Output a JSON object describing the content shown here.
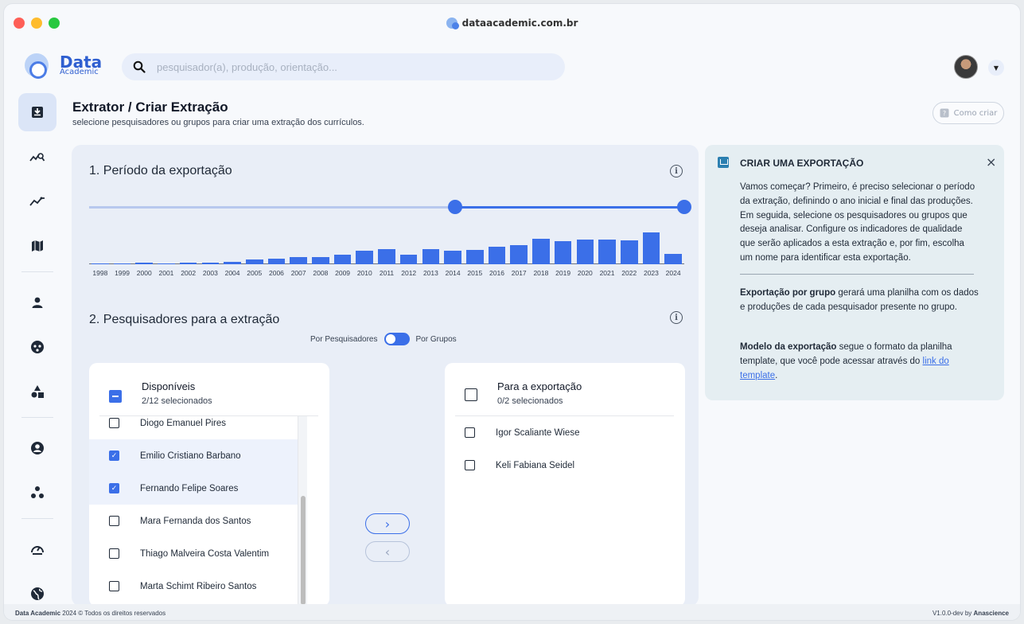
{
  "browser": {
    "url": "dataacademic.com.br"
  },
  "app": {
    "logo_big": "Data",
    "logo_small": "Academic"
  },
  "search": {
    "placeholder": "pesquisador(a), produção, orientação..."
  },
  "sidebar": {
    "items": [
      {
        "icon": "download-icon",
        "active": true
      },
      {
        "icon": "trend-search-icon"
      },
      {
        "icon": "sparkline-icon"
      },
      {
        "icon": "map-icon"
      },
      {
        "icon": "person-icon"
      },
      {
        "icon": "face-icon"
      },
      {
        "icon": "shapes-icon"
      },
      {
        "icon": "account-circle-icon"
      },
      {
        "icon": "group-dots-icon"
      },
      {
        "icon": "gauge-icon"
      },
      {
        "icon": "globe-icon"
      }
    ]
  },
  "header": {
    "title": "Extrator / Criar Extração",
    "subtitle": "selecione pesquisadores ou grupos para criar uma extração dos currículos.",
    "how_button": "Como criar"
  },
  "period": {
    "title": "1. Período da exportação",
    "range_start_year": 2014,
    "range_end_year": 2024
  },
  "chart_data": {
    "type": "bar",
    "categories": [
      "1998",
      "1999",
      "2000",
      "2001",
      "2002",
      "2003",
      "2004",
      "2005",
      "2006",
      "2007",
      "2008",
      "2009",
      "2010",
      "2011",
      "2012",
      "2013",
      "2014",
      "2015",
      "2016",
      "2017",
      "2018",
      "2019",
      "2020",
      "2021",
      "2022",
      "2023",
      "2024"
    ],
    "values": [
      1,
      1,
      2,
      1,
      2,
      2,
      3,
      5,
      6,
      8,
      8,
      11,
      15,
      17,
      11,
      17,
      15,
      16,
      20,
      22,
      29,
      26,
      28,
      28,
      27,
      36,
      12
    ],
    "ylim": [
      0,
      36
    ],
    "title": "",
    "xlabel": "",
    "ylabel": ""
  },
  "researchers": {
    "title": "2. Pesquisadores para a extração",
    "toggle_left": "Por Pesquisadores",
    "toggle_right": "Por Grupos",
    "available": {
      "title": "Disponíveis",
      "count": "2/12 selecionados",
      "items": [
        {
          "name": "Diogo Emanuel Pires",
          "checked": false
        },
        {
          "name": "Emilio Cristiano Barbano",
          "checked": true
        },
        {
          "name": "Fernando Felipe Soares",
          "checked": true
        },
        {
          "name": "Mara Fernanda dos Santos",
          "checked": false
        },
        {
          "name": "Thiago Malveira Costa Valentim",
          "checked": false
        },
        {
          "name": "Marta Schimt Ribeiro Santos",
          "checked": false
        }
      ]
    },
    "export": {
      "title": "Para a exportação",
      "count": "0/2 selecionados",
      "items": [
        {
          "name": "Igor Scaliante Wiese",
          "checked": false
        },
        {
          "name": "Keli Fabiana Seidel",
          "checked": false
        }
      ]
    },
    "move_right": "›",
    "move_left": "‹"
  },
  "help": {
    "title": "CRIAR UMA EXPORTAÇÃO",
    "close": "×",
    "p1": "Vamos começar? Primeiro, é preciso selecionar o período da extração, definindo o ano inicial e final das produções. Em seguida, selecione os pesquisadores ou grupos que deseja analisar. Configure os indicadores de qualidade que serão aplicados a esta extração e, por fim, escolha um nome para identificar esta exportação.",
    "p2_bold": "Exportação por grupo",
    "p2_rest": " gerará uma planilha com os dados e produções de cada pesquisador presente no grupo.",
    "p3_bold": "Modelo da exportação",
    "p3_rest": " segue o formato da planilha template, que você pode acessar através do ",
    "p3_link": "link do template",
    "p3_end": "."
  },
  "footer": {
    "brand": "Data Academic",
    "copyright": " 2024 © Todos os direitos reservados",
    "version": "V1.0.0-dev by ",
    "vendor": "Anascience"
  },
  "colors": {
    "accent": "#3b6fe8",
    "accent_light": "#b7c8ee",
    "help_bg": "#e5eef2"
  }
}
